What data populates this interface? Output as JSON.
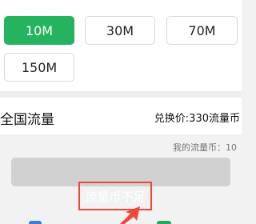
{
  "options": [
    {
      "label": "10M",
      "selected": true
    },
    {
      "label": "30M",
      "selected": false
    },
    {
      "label": "70M",
      "selected": false
    },
    {
      "label": "150M",
      "selected": false
    }
  ],
  "info": {
    "title": "全国流量",
    "price_label": "兑换价:",
    "price_value": "330流量币"
  },
  "balance": "我的流量币：10",
  "action": {
    "label": "流量币不足",
    "state": "disabled"
  },
  "colors": {
    "selected_green": "#26b35f",
    "highlight_red": "#f0473b",
    "disabled_gray": "#d1d1d1"
  }
}
